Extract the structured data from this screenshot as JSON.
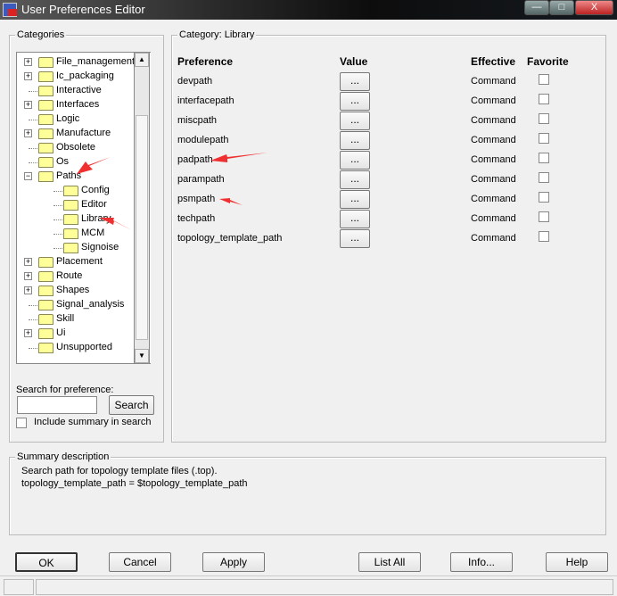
{
  "window": {
    "title": "User Preferences Editor",
    "minimize": "—",
    "maximize": "□",
    "close": "X"
  },
  "categories": {
    "label": "Categories",
    "items": [
      {
        "label": "File_management",
        "expander": "+",
        "level": 0
      },
      {
        "label": "Ic_packaging",
        "expander": "+",
        "level": 0
      },
      {
        "label": "Interactive",
        "expander": "",
        "level": 0
      },
      {
        "label": "Interfaces",
        "expander": "+",
        "level": 0
      },
      {
        "label": "Logic",
        "expander": "",
        "level": 0
      },
      {
        "label": "Manufacture",
        "expander": "+",
        "level": 0
      },
      {
        "label": "Obsolete",
        "expander": "",
        "level": 0
      },
      {
        "label": "Os",
        "expander": "",
        "level": 0
      },
      {
        "label": "Paths",
        "expander": "−",
        "level": 0
      },
      {
        "label": "Config",
        "expander": "",
        "level": 1
      },
      {
        "label": "Editor",
        "expander": "",
        "level": 1
      },
      {
        "label": "Library",
        "expander": "",
        "level": 1,
        "selected": true
      },
      {
        "label": "MCM",
        "expander": "",
        "level": 1
      },
      {
        "label": "Signoise",
        "expander": "",
        "level": 1
      },
      {
        "label": "Placement",
        "expander": "+",
        "level": 0
      },
      {
        "label": "Route",
        "expander": "+",
        "level": 0
      },
      {
        "label": "Shapes",
        "expander": "+",
        "level": 0
      },
      {
        "label": "Signal_analysis",
        "expander": "",
        "level": 0
      },
      {
        "label": "Skill",
        "expander": "",
        "level": 0
      },
      {
        "label": "Ui",
        "expander": "+",
        "level": 0
      },
      {
        "label": "Unsupported",
        "expander": "",
        "level": 0
      }
    ],
    "search_label": "Search for preference:",
    "search_value": "",
    "search_button": "Search",
    "include_summary": "Include summary in search",
    "include_summary_checked": false
  },
  "category_panel": {
    "label": "Category:  Library",
    "headers": {
      "preference": "Preference",
      "value": "Value",
      "effective": "Effective",
      "favorite": "Favorite"
    },
    "rows": [
      {
        "name": "devpath",
        "value": "...",
        "effective": "Command",
        "favorite": false
      },
      {
        "name": "interfacepath",
        "value": "...",
        "effective": "Command",
        "favorite": false
      },
      {
        "name": "miscpath",
        "value": "...",
        "effective": "Command",
        "favorite": false
      },
      {
        "name": "modulepath",
        "value": "...",
        "effective": "Command",
        "favorite": false
      },
      {
        "name": "padpath",
        "value": "...",
        "effective": "Command",
        "favorite": false
      },
      {
        "name": "parampath",
        "value": "...",
        "effective": "Command",
        "favorite": false
      },
      {
        "name": "psmpath",
        "value": "...",
        "effective": "Command",
        "favorite": false
      },
      {
        "name": "techpath",
        "value": "...",
        "effective": "Command",
        "favorite": false
      },
      {
        "name": "topology_template_path",
        "value": "...",
        "effective": "Command",
        "favorite": false
      }
    ]
  },
  "summary": {
    "label": "Summary description",
    "line1": "Search path for topology template files (.top).",
    "line2": "topology_template_path = $topology_template_path"
  },
  "buttons": {
    "ok": "OK",
    "cancel": "Cancel",
    "apply": "Apply",
    "list_all": "List All",
    "info": "Info...",
    "help": "Help"
  },
  "colors": {
    "annotation_arrow": "#f03030",
    "folder": "#ffff99"
  }
}
